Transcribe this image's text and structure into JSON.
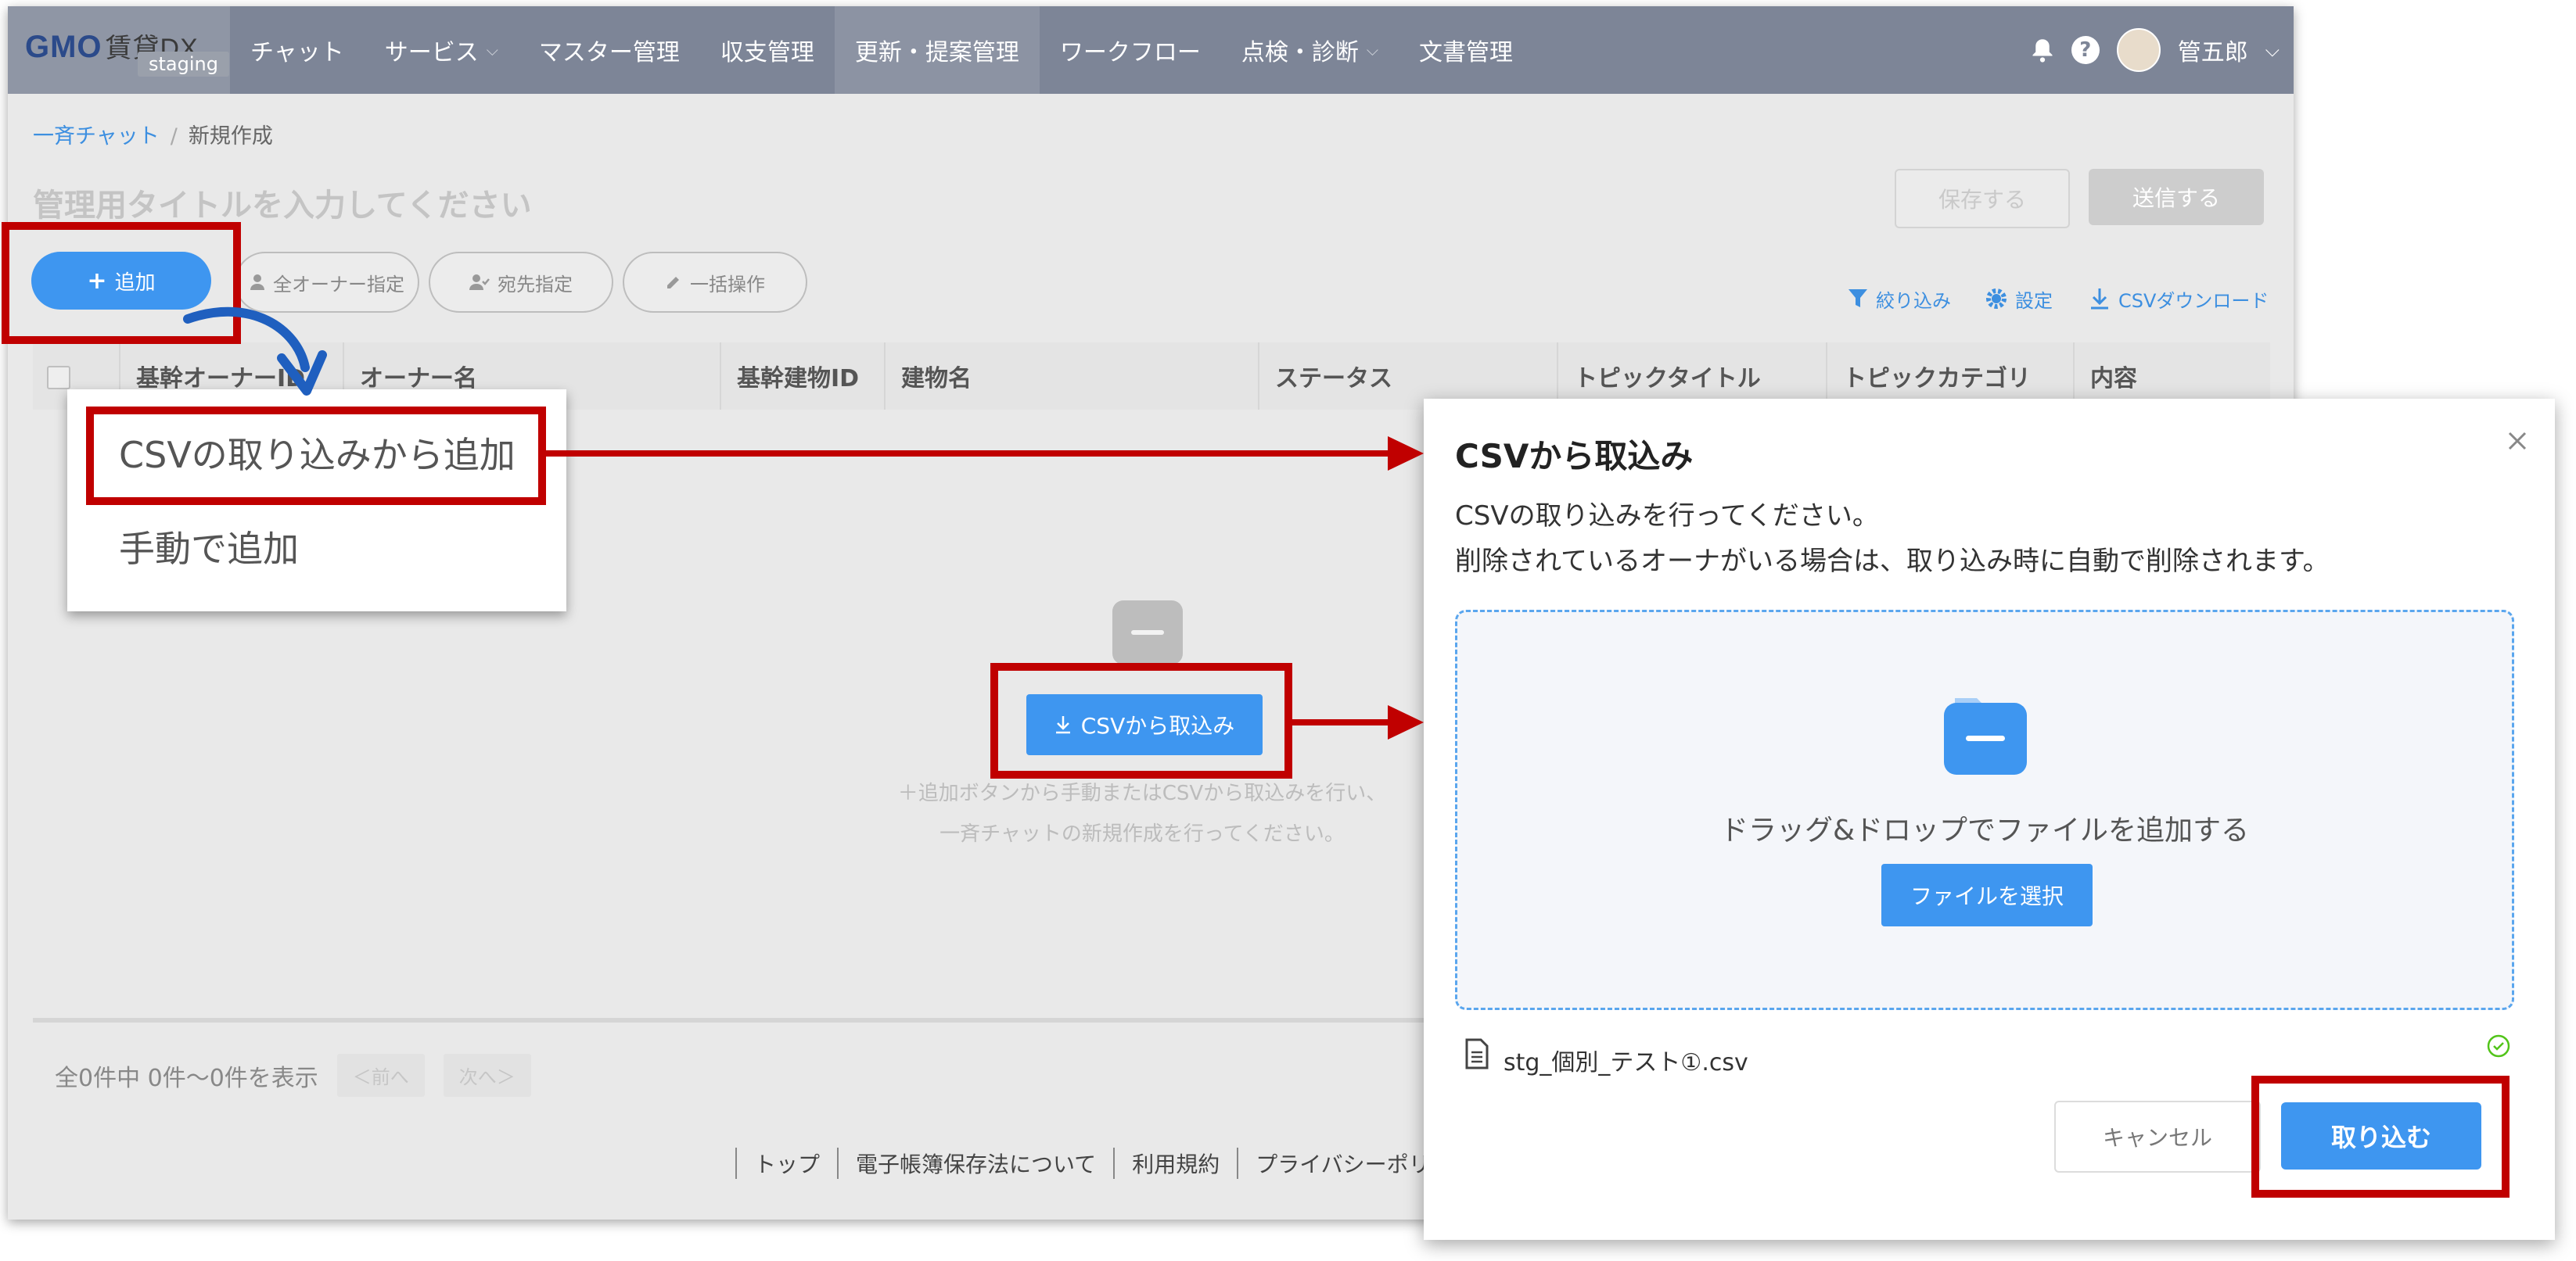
{
  "nav": {
    "logo_text": "GMO",
    "logo_sub": "賃貸DX",
    "env_badge": "staging",
    "items": [
      {
        "label": "チャット",
        "has_dropdown": false
      },
      {
        "label": "サービス",
        "has_dropdown": true
      },
      {
        "label": "マスター管理",
        "has_dropdown": false
      },
      {
        "label": "収支管理",
        "has_dropdown": false
      },
      {
        "label": "更新・提案管理",
        "has_dropdown": false,
        "active": true
      },
      {
        "label": "ワークフロー",
        "has_dropdown": false
      },
      {
        "label": "点検・診断",
        "has_dropdown": true
      },
      {
        "label": "文書管理",
        "has_dropdown": false
      }
    ],
    "help_glyph": "?",
    "user_name": "管五郎"
  },
  "breadcrumb": {
    "parent": "一斉チャット",
    "separator": "/",
    "current": "新規作成"
  },
  "page": {
    "title_placeholder": "管理用タイトルを入力してください",
    "save_label": "保存する",
    "send_label": "送信する"
  },
  "toolbar": {
    "add_label": "追加",
    "all_owner_label": "全オーナー指定",
    "recipient_label": "宛先指定",
    "bulk_label": "一括操作",
    "filter_label": "絞り込み",
    "settings_label": "設定",
    "csv_download_label": "CSVダウンロード"
  },
  "table": {
    "columns": [
      "基幹オーナーID",
      "オーナー名",
      "基幹建物ID",
      "建物名",
      "ステータス",
      "トピックタイトル",
      "トピックカテゴリ",
      "内容"
    ]
  },
  "empty_state": {
    "csv_button_label": "CSVから取込み",
    "line1": "＋追加ボタンから手動またはCSVから取込みを行い、",
    "line2": "一斉チャットの新規作成を行ってください。"
  },
  "pager": {
    "summary": "全0件中 0件〜0件を表示",
    "prev_label": "＜前へ",
    "next_label": "次へ＞"
  },
  "footer": {
    "links": [
      "トップ",
      "電子帳簿保存法について",
      "利用規約",
      "プライバシーポリシー"
    ]
  },
  "menu": {
    "items": [
      "CSVの取り込みから追加",
      "手動で追加"
    ]
  },
  "dialog": {
    "title": "CSVから取込み",
    "desc1": "CSVの取り込みを行ってください。",
    "desc2": "削除されているオーナがいる場合は、取り込み時に自動で削除されます。",
    "dropzone_text": "ドラッグ&ドロップでファイルを追加する",
    "select_file_label": "ファイルを選択",
    "file_name": "stg_個別_テスト①.csv",
    "cancel_label": "キャンセル",
    "import_label": "取り込む"
  },
  "colors": {
    "nav_bg": "#7d8597",
    "primary": "#3e96f0",
    "annotation_red": "#c00000",
    "annotation_blue": "#1f5fbf"
  }
}
